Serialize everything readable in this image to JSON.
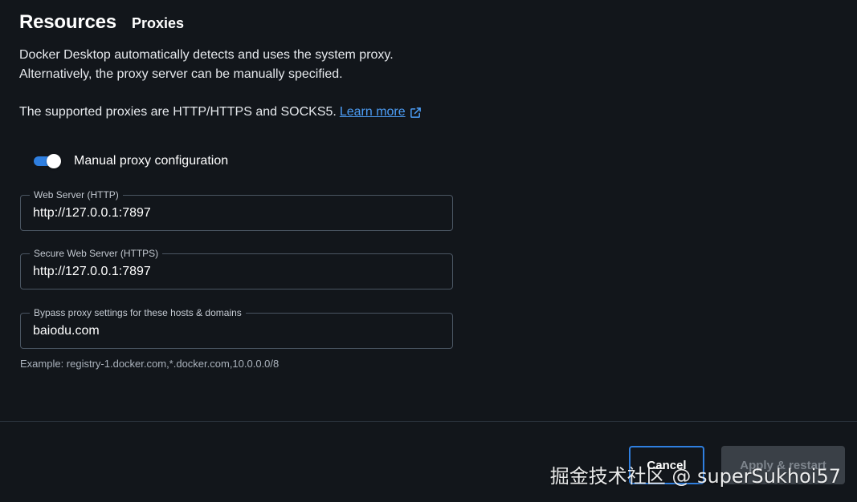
{
  "header": {
    "title": "Resources",
    "subtitle": "Proxies"
  },
  "description": {
    "line1": "Docker Desktop automatically detects and uses the system proxy.",
    "line2": "Alternatively, the proxy server can be manually specified.",
    "supported": "The supported proxies are HTTP/HTTPS and SOCKS5.",
    "learn_more": "Learn more"
  },
  "manual_proxy": {
    "label": "Manual proxy configuration",
    "enabled": true
  },
  "fields": {
    "http": {
      "label": "Web Server (HTTP)",
      "value": "http://127.0.0.1:7897"
    },
    "https": {
      "label": "Secure Web Server (HTTPS)",
      "value": "http://127.0.0.1:7897"
    },
    "bypass": {
      "label": "Bypass proxy settings for these hosts & domains",
      "value": "baiodu.com"
    }
  },
  "hint": "Example: registry-1.docker.com,*.docker.com,10.0.0.0/8",
  "footer": {
    "cancel_label": "Cancel",
    "apply_label": "Apply & restart"
  },
  "watermark": "掘金技术社区 @ superSukhoi57",
  "colors": {
    "background": "#12161b",
    "accent": "#2f7fe0",
    "link": "#4c9df5"
  },
  "icons": [
    "external-link-icon"
  ]
}
